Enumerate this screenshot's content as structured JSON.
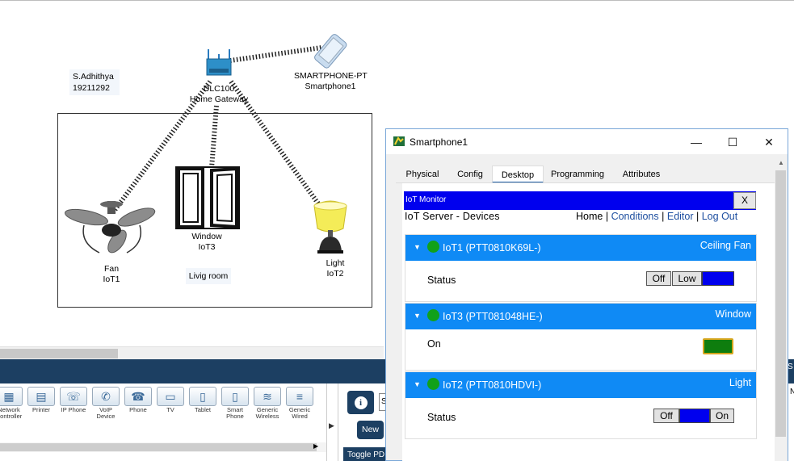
{
  "workspace": {
    "note": {
      "line1": "S.Adhithya",
      "line2": "19211292"
    },
    "gateway": {
      "model": "DLC100",
      "name": "Home Gateway"
    },
    "smartphone": {
      "model": "SMARTPHONE-PT",
      "name": "Smartphone1"
    },
    "room_label": "Livig room",
    "devices": [
      {
        "type": "Fan",
        "name": "IoT1"
      },
      {
        "type": "Window",
        "name": "IoT3"
      },
      {
        "type": "Light",
        "name": "IoT2"
      }
    ]
  },
  "palette": {
    "items": [
      {
        "label1": "Network",
        "label2": "Controller"
      },
      {
        "label1": "Printer",
        "label2": ""
      },
      {
        "label1": "IP Phone",
        "label2": ""
      },
      {
        "label1": "VoIP",
        "label2": "Device"
      },
      {
        "label1": "Phone",
        "label2": ""
      },
      {
        "label1": "TV",
        "label2": ""
      },
      {
        "label1": "Tablet",
        "label2": ""
      },
      {
        "label1": "Smart",
        "label2": "Phone"
      },
      {
        "label1": "Generic",
        "label2": "Wireless"
      },
      {
        "label1": "Generic",
        "label2": "Wired"
      }
    ],
    "info_icon": "i",
    "new_label": "New",
    "toggle_label": "Toggle PD",
    "search_value": "S",
    "edge_text": "N",
    "edge_box": "S"
  },
  "window": {
    "title": "Smartphone1",
    "controls": {
      "minimize": "—",
      "maximize": "☐",
      "close": "✕"
    },
    "tabs": [
      "Physical",
      "Config",
      "Desktop",
      "Programming",
      "Attributes"
    ],
    "active_tab": "Desktop",
    "monitor": {
      "bar_title": "IoT Monitor",
      "close_label": "X",
      "server_title": "IoT Server - Devices",
      "nav": {
        "home": "Home",
        "conditions": "Conditions",
        "editor": "Editor",
        "logout": "Log Out",
        "sep": "|"
      }
    },
    "cards": [
      {
        "caret": "▼",
        "name": "IoT1 (PTT0810K69L-)",
        "type": "Ceiling Fan",
        "label": "Status",
        "buttons": [
          "Off",
          "Low"
        ]
      },
      {
        "caret": "▼",
        "name": "IoT3 (PTT081048HE-)",
        "type": "Window",
        "label": "On"
      },
      {
        "caret": "▼",
        "name": "IoT2 (PTT0810HDVI-)",
        "type": "Light",
        "label": "Status",
        "buttons": [
          "Off",
          "On"
        ]
      }
    ]
  },
  "colors": {
    "accent_blue": "#0f8af5",
    "monitor_blue": "#0000ee",
    "palette_bg": "#1c3f62",
    "status_green": "#11a11a"
  }
}
